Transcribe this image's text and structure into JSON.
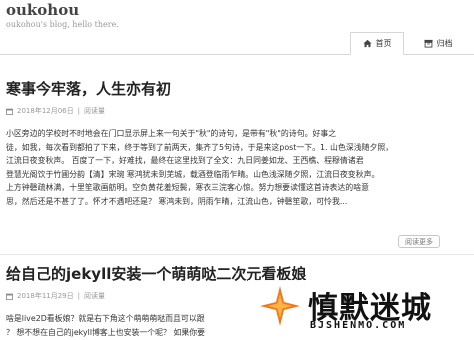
{
  "site": {
    "title": "oukohou",
    "description": "oukohou's blog, hello there."
  },
  "nav": {
    "home_label": "首页",
    "home_icon": "home-icon",
    "archive_label": "归档",
    "archive_icon": "archive-icon"
  },
  "posts": [
    {
      "title": "寒事今牢落，人生亦有初",
      "date": "2018年12月06日",
      "read_label": "阅读量",
      "body_lines": [
        "小区旁边的学校时不时地会在门口显示屏上来一句关于\"秋\"的诗句，是带有\"秋\"的诗句。好事之",
        "徒，如我，每次看到都拍了下来，终于等到了前两天，集齐了5句诗，于是来这post一下。1. 山色深浅随夕照，",
        "江流日夜变秋声。  百度了一下，好难找，最终在这里找到了全文：九日同姜如龙、王西樵、程穆倩诸君",
        "登慧光阁饮于竹圃分韵【清】宋琬 寒鸿犹未到芜城，载酒登临雨乍晴。山色浅深随夕照，江流日夜变秋声。",
        "上方钟磬疏林满，十里笙歌画舫明。空负黄花羞短鬓，寒衣三浣客心惊。努力想要读懂这首诗表达的啥意",
        "思，然后还是不甚了了。怀才不遇吧还是？ 寒鸿未到，阴雨乍晴，江流山色，钟磬笙歌，可怜我..."
      ],
      "more_label": "阅读更多"
    },
    {
      "title": "给自己的jekyll安装一个萌萌哒二次元看板娘",
      "date": "2018年11月29日",
      "read_label": "阅读量",
      "body_lines": [
        "啥是live2D看板娘？就是右下角这个萌萌萌哒而且可以跟",
        "？ 想不想在自己的jekyll博客上也安装一个呢？ 如果你要"
      ]
    }
  ],
  "watermark": {
    "brand": "慎默迷城",
    "site": "BJSHENMO.COM",
    "accent_color": "#f07a1a"
  }
}
